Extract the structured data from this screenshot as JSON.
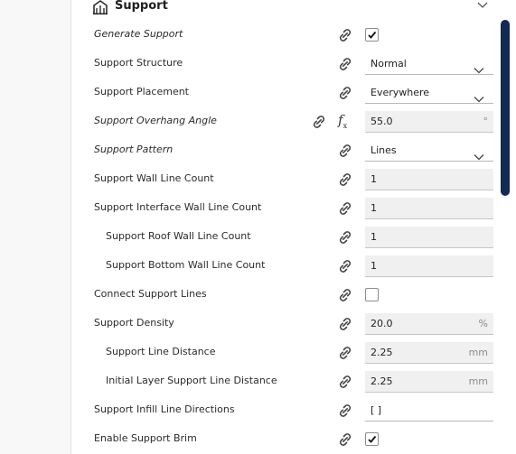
{
  "section": {
    "title": "Support",
    "icon": "support-icon"
  },
  "rows": [
    {
      "label": "Generate Support",
      "italic": true,
      "control": "checkbox",
      "checked": true
    },
    {
      "label": "Support Structure",
      "control": "dropdown",
      "value": "Normal"
    },
    {
      "label": "Support Placement",
      "control": "dropdown",
      "value": "Everywhere"
    },
    {
      "label": "Support Overhang Angle",
      "italic": true,
      "control": "number",
      "value": "55.0",
      "unit": "°",
      "has_formula": true
    },
    {
      "label": "Support Pattern",
      "italic": true,
      "control": "dropdown",
      "value": "Lines"
    },
    {
      "label": "Support Wall Line Count",
      "control": "number",
      "value": "1"
    },
    {
      "label": "Support Interface Wall Line Count",
      "control": "number",
      "value": "1"
    },
    {
      "label": "Support Roof Wall Line Count",
      "indent": 1,
      "control": "number",
      "value": "1"
    },
    {
      "label": "Support Bottom Wall Line Count",
      "indent": 1,
      "control": "number",
      "value": "1"
    },
    {
      "label": "Connect Support Lines",
      "control": "checkbox",
      "checked": false
    },
    {
      "label": "Support Density",
      "control": "number",
      "value": "20.0",
      "unit": "%"
    },
    {
      "label": "Support Line Distance",
      "indent": 1,
      "control": "number",
      "value": "2.25",
      "unit": "mm"
    },
    {
      "label": "Initial Layer Support Line Distance",
      "indent": 1,
      "control": "number",
      "value": "2.25",
      "unit": "mm"
    },
    {
      "label": "Support Infill Line Directions",
      "control": "text",
      "value": "[ ]"
    },
    {
      "label": "Enable Support Brim",
      "control": "checkbox",
      "checked": true
    }
  ],
  "colors": {
    "scrollbar": "#132a52",
    "field_bg": "#f0f0f0"
  },
  "icons": {
    "link": "link-icon",
    "formula": "formula-icon",
    "chevron": "chevron-down-icon",
    "check": "check-icon"
  }
}
